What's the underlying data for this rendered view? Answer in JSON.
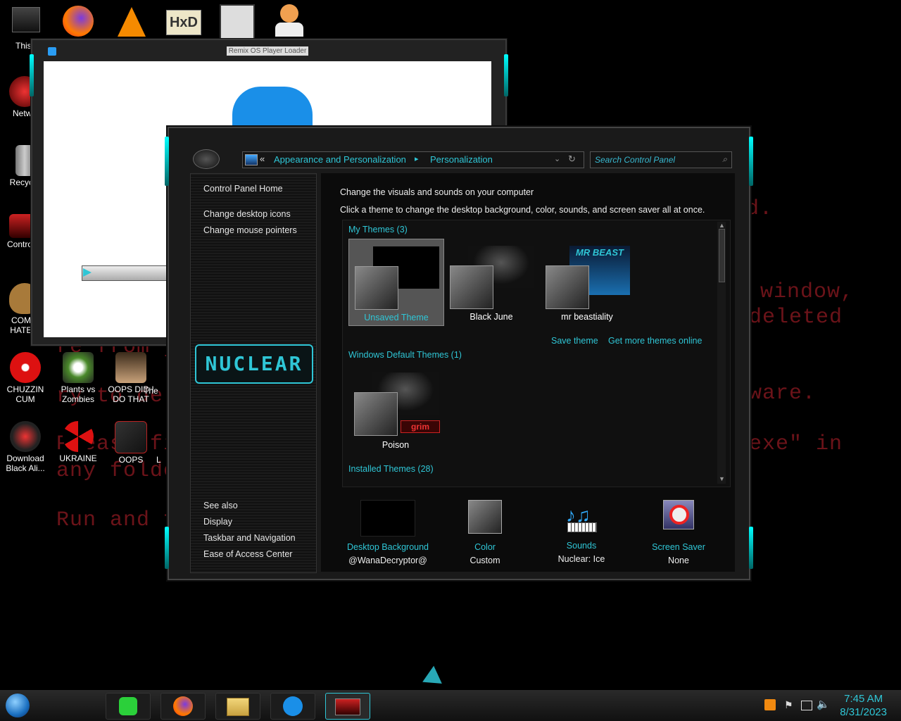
{
  "desktop": {
    "background_text": [
      "d.",
      "window,",
      "deleted",
      "re from y",
      "ry to de",
      "ware.",
      "Please fi",
      "exe\" in",
      "any folde",
      "Run and f"
    ],
    "icons": [
      {
        "label": "This P",
        "icon": "computer-icon"
      },
      {
        "label": "Netwo",
        "icon": "network-icon"
      },
      {
        "label": "Recycle",
        "icon": "recycle-bin-icon"
      },
      {
        "label": "Control P",
        "icon": "control-panel-icon"
      },
      {
        "label": "COMM HATE T",
        "icon": "money-bag-icon"
      },
      {
        "label": "CHUZZIN CUM",
        "icon": "chuzzle-icon"
      },
      {
        "label": "Plants vs Zombies",
        "icon": "plants-vs-zombies-icon"
      },
      {
        "label": "OOPS DID I DO THAT",
        "icon": "portrait-icon"
      },
      {
        "label": "The",
        "icon": "generic-icon"
      },
      {
        "label": "Download Black Ali...",
        "icon": "alien-icon"
      },
      {
        "label": "UKRAINE",
        "icon": "radiation-icon"
      },
      {
        "label": "OOPS",
        "icon": "oops-icon"
      },
      {
        "label": "L",
        "icon": "generic-icon"
      }
    ],
    "top_icons": [
      "firefox-icon",
      "vlc-icon",
      "hxd-icon",
      "app-icon",
      "doctor-icon"
    ]
  },
  "background_window": {
    "title": "Remix OS Player Loader"
  },
  "window": {
    "breadcrumb": {
      "back": "«",
      "level1": "Appearance and Personalization",
      "separator": "▸",
      "level2": "Personalization"
    },
    "search_placeholder": "Search Control Panel",
    "sidebar": {
      "home": "Control Panel Home",
      "links": [
        "Change desktop icons",
        "Change mouse pointers"
      ],
      "logo_text": "NUCLEAR",
      "see_also_title": "See also",
      "see_also": [
        "Display",
        "Taskbar and Navigation",
        "Ease of Access Center"
      ]
    },
    "content": {
      "heading": "Change the visuals and sounds on your computer",
      "subheading": "Click a theme to change the desktop background, color, sounds, and screen saver all at once.",
      "my_themes_header": "My Themes (3)",
      "my_themes": [
        {
          "name": "Unsaved Theme",
          "selected": true
        },
        {
          "name": "Black June",
          "selected": false
        },
        {
          "name": "mr beastiality",
          "selected": false
        }
      ],
      "save_theme": "Save theme",
      "get_more_themes": "Get more themes online",
      "default_themes_header": "Windows Default Themes (1)",
      "default_themes": [
        {
          "name": "Poison",
          "badge": "grim"
        }
      ],
      "installed_themes_header": "Installed Themes (28)",
      "theme_banner_text": "MR BEAST",
      "bottom_items": [
        {
          "label": "Desktop Background",
          "value": "@WanaDecryptor@",
          "icon": "desktop-background-icon"
        },
        {
          "label": "Color",
          "value": "Custom",
          "icon": "color-swatch-icon"
        },
        {
          "label": "Sounds",
          "value": "Nuclear: Ice",
          "icon": "sounds-icon"
        },
        {
          "label": "Screen Saver",
          "value": "None",
          "icon": "screen-saver-icon"
        }
      ]
    }
  },
  "taskbar": {
    "clock": {
      "time": "7:45 AM",
      "date": "8/31/2023"
    },
    "buttons": [
      "notes-app-icon",
      "firefox-icon",
      "file-explorer-icon",
      "remix-os-icon",
      "control-panel-icon"
    ]
  },
  "colors": {
    "accent": "#2fc6d6",
    "background": "#000000",
    "ransom_text": "#c4232e"
  }
}
